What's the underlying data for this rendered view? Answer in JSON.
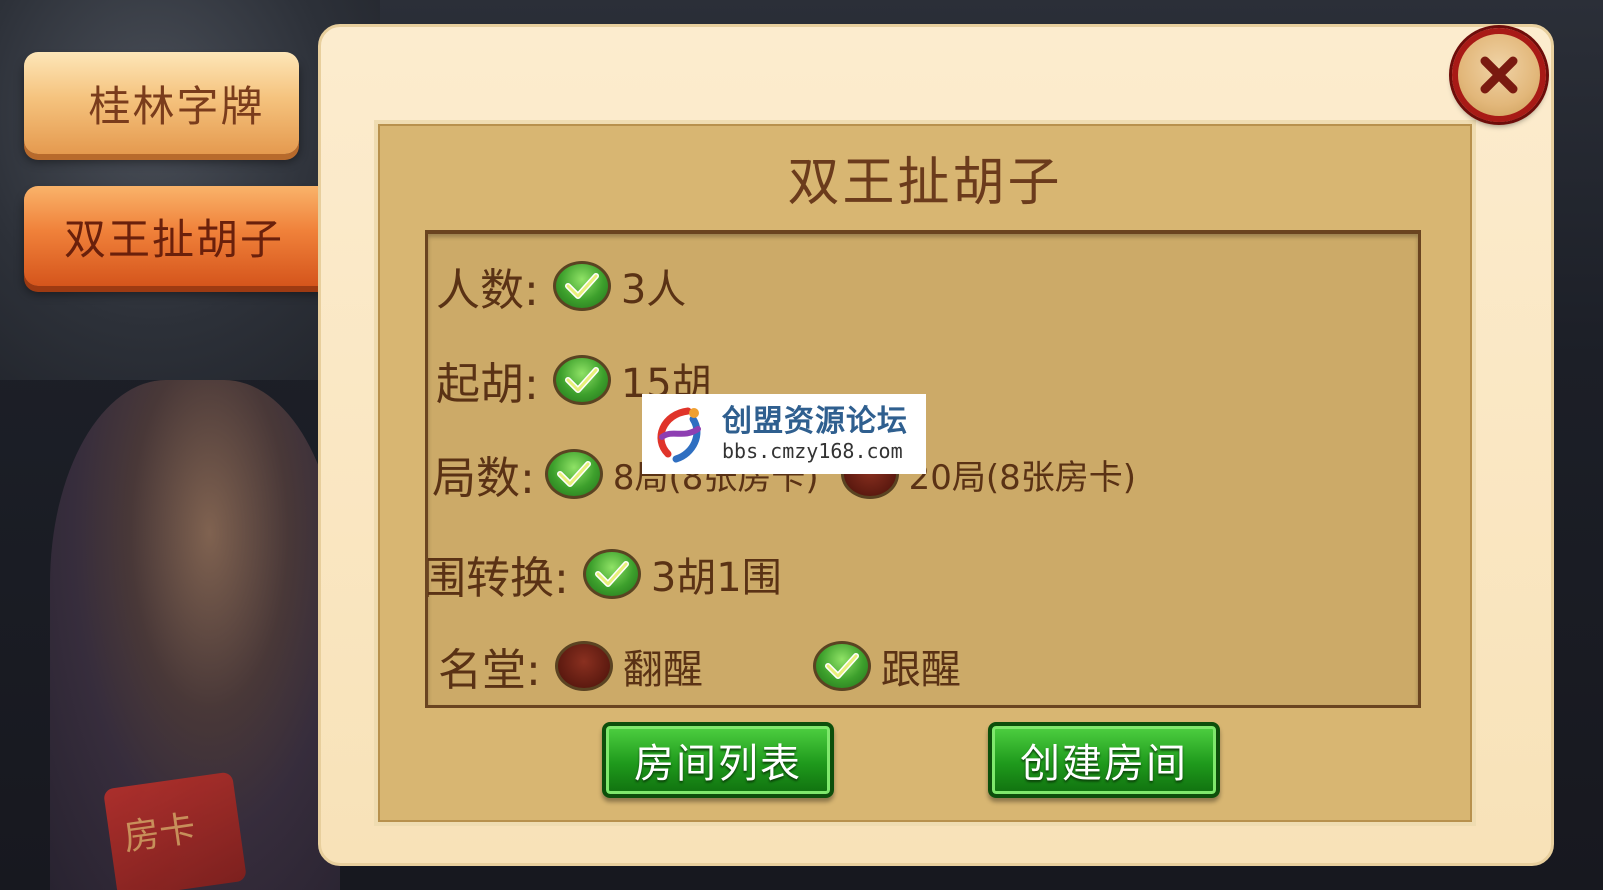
{
  "tabs": [
    {
      "label": "桂林字牌",
      "active": false
    },
    {
      "label": "双王扯胡子",
      "active": true
    }
  ],
  "panel": {
    "title": "双王扯胡子"
  },
  "options": {
    "players": {
      "label": "人数:",
      "choices": [
        {
          "text": "3人",
          "selected": true
        }
      ]
    },
    "start_hu": {
      "label": "起胡:",
      "choices": [
        {
          "text": "15胡",
          "selected": true
        }
      ]
    },
    "rounds": {
      "label": "局数:",
      "choices": [
        {
          "text": "8局(8张房卡)",
          "selected": true
        },
        {
          "text": "20局(8张房卡)",
          "selected": false
        }
      ]
    },
    "wei_convert": {
      "label": "围转换:",
      "choices": [
        {
          "text": "3胡1围",
          "selected": true
        }
      ]
    },
    "ming_tang": {
      "label": "名堂:",
      "choices": [
        {
          "text": "翻醒",
          "selected": false
        },
        {
          "text": "跟醒",
          "selected": true
        }
      ]
    }
  },
  "buttons": {
    "room_list": "房间列表",
    "create_room": "创建房间"
  },
  "background": {
    "card_text": "房卡"
  },
  "watermark": {
    "title": "创盟资源论坛",
    "url": "bbs.cmzy168.com"
  },
  "colors": {
    "panel_bg": "#f8e2b8",
    "options_bg": "#ccaa68",
    "text_brown": "#5a3215",
    "button_green": "#1f9a1c",
    "close_red": "#a81a16",
    "tab_active": "#f0813a",
    "tab_inactive": "#f5c37e"
  }
}
